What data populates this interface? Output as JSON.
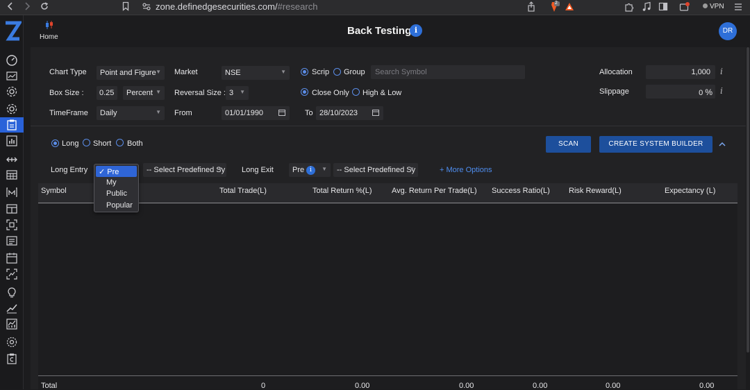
{
  "browser": {
    "url_domain": "zone.definedgesecurities.com/",
    "url_hash": "#research",
    "vpn_label": "VPN",
    "shield_badge_count": "2",
    "icons": [
      "back-icon",
      "forward-icon",
      "reload-icon",
      "bookmark-icon",
      "site-info-icon",
      "share-icon",
      "brave-shield-icon",
      "rewards-icon",
      "extensions-icon",
      "media-icon",
      "sidebar-icon",
      "wallet-icon",
      "menu-icon"
    ]
  },
  "header": {
    "home_label": "Home",
    "title": "Back Testing",
    "info_glyph": "i",
    "avatar_initials": "DR"
  },
  "sidebar": {
    "logo": "Z",
    "icons": [
      "dashboard-icon",
      "chart-icon",
      "settings-gear-icon",
      "gear-icon",
      "backtest-clipboard-icon",
      "bar-chart-icon",
      "range-icon",
      "calendar-grid-icon",
      "market-m-icon",
      "table-icon",
      "scan-icon",
      "list-icon",
      "calendar-icon",
      "screener-icon",
      "idea-bulb-icon",
      "trend-icon",
      "analytics-icon",
      "options-icon",
      "portfolio-icon"
    ]
  },
  "form": {
    "chart_type_label": "Chart Type",
    "chart_type_value": "Point and Figure",
    "market_label": "Market",
    "market_value": "NSE",
    "scrip_label": "Scrip",
    "group_label": "Group",
    "search_placeholder": "Search Symbol",
    "allocation_label": "Allocation",
    "allocation_value": "1,000",
    "box_size_label": "Box Size :",
    "box_size_value": "0.25",
    "box_unit_value": "Percent",
    "reversal_label": "Reversal Size :",
    "reversal_value": "3",
    "close_only_label": "Close Only",
    "high_low_label": "High & Low",
    "slippage_label": "Slippage",
    "slippage_value": "0",
    "slippage_unit": "%",
    "timeframe_label": "TimeFrame",
    "timeframe_value": "Daily",
    "from_label": "From",
    "from_value": "01/01/1990",
    "to_label": "To",
    "to_value": "28/10/2023",
    "info_i": "i"
  },
  "strategy": {
    "long_label": "Long",
    "short_label": "Short",
    "both_label": "Both",
    "scan_button": "SCAN",
    "create_button": "CREATE SYSTEM BUILDER",
    "long_entry_label": "Long Entry",
    "entry_predefined": "-- Select Predefined Sy",
    "long_exit_label": "Long Exit",
    "exit_type_value": "Pre",
    "exit_predefined": "-- Select Predefined Sy",
    "more_options": "+ More Options"
  },
  "entry_dropdown": {
    "options": [
      "Pre",
      "My",
      "Public",
      "Popular"
    ],
    "selected_check": "✓"
  },
  "table": {
    "headers": [
      "Symbol",
      "Total Trade(L)",
      "Total Return %(L)",
      "Avg. Return Per Trade(L)",
      "Success Ratio(L)",
      "Risk Reward(L)",
      "Expectancy (L)"
    ],
    "footer": [
      "Total",
      "0",
      "0.00",
      "0.00",
      "0.00",
      "0.00",
      "0.00"
    ]
  },
  "colors": {
    "accent": "#2e6fd8",
    "button": "#1d4f9c",
    "link": "#4f8ef0",
    "background": "#1c1c1e",
    "panel": "#222224"
  }
}
